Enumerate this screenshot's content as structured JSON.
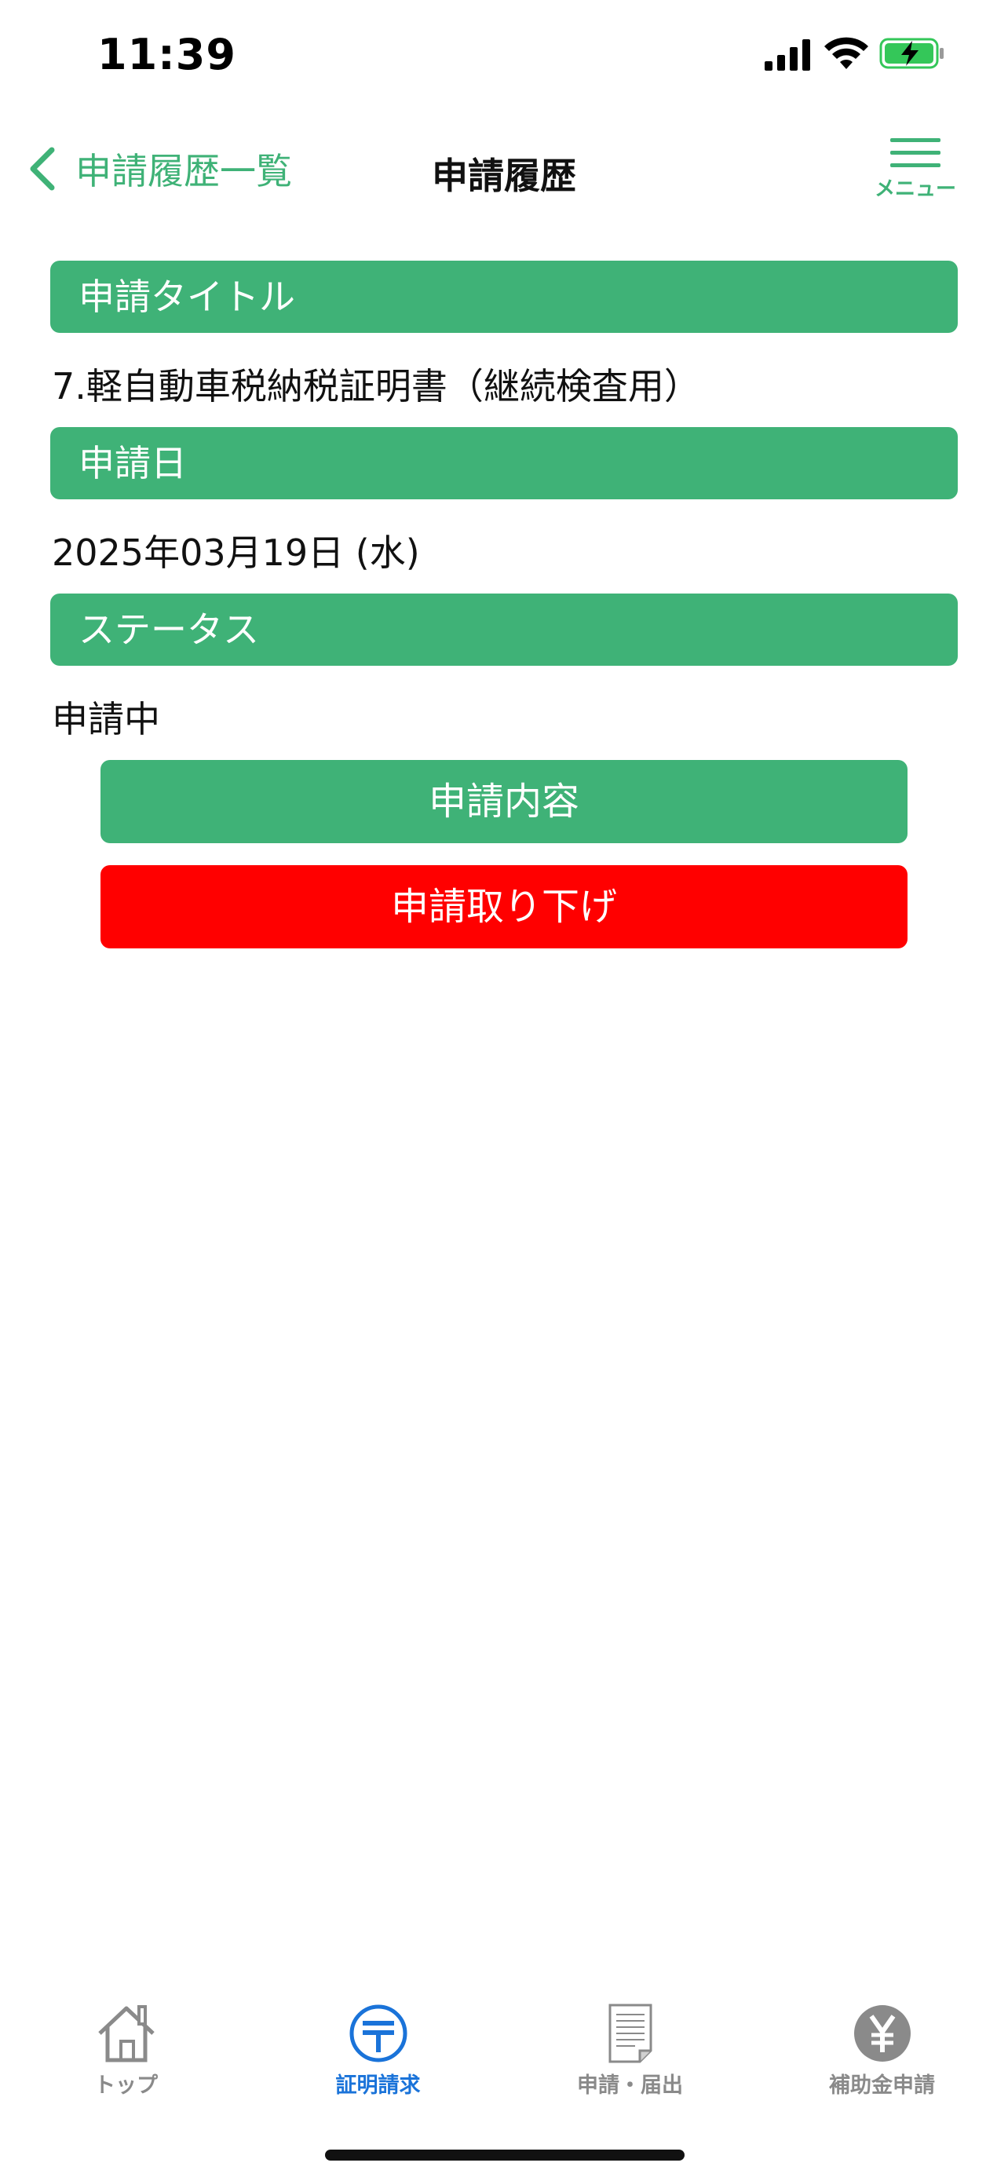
{
  "status_bar": {
    "time": "11:39",
    "icons": [
      "cellular-signal-icon",
      "wifi-icon",
      "battery-charging-icon"
    ],
    "battery_color": "#34c759"
  },
  "nav": {
    "back_label": "申請履歴一覧",
    "title": "申請履歴",
    "menu_label": "メニュー"
  },
  "sections": {
    "title_header": "申請タイトル",
    "title_value": "7.軽自動車税納税証明書（継続検査用）",
    "date_header": "申請日",
    "date_value": "2025年03月19日 (水)",
    "status_header": "ステータス",
    "status_value": "申請中"
  },
  "buttons": {
    "content_label": "申請内容",
    "withdraw_label": "申請取り下げ"
  },
  "tabs": [
    {
      "label": "トップ",
      "icon": "house-icon",
      "active": false
    },
    {
      "label": "証明請求",
      "icon": "postal-mark-icon",
      "active": true
    },
    {
      "label": "申請・届出",
      "icon": "document-icon",
      "active": false
    },
    {
      "label": "補助金申請",
      "icon": "yen-coin-icon",
      "active": false
    }
  ],
  "colors": {
    "accent_green": "#3fb277",
    "danger_red": "#ff0000",
    "active_tab_blue": "#1a73d9",
    "inactive_tab_gray": "#8a8a8a"
  }
}
